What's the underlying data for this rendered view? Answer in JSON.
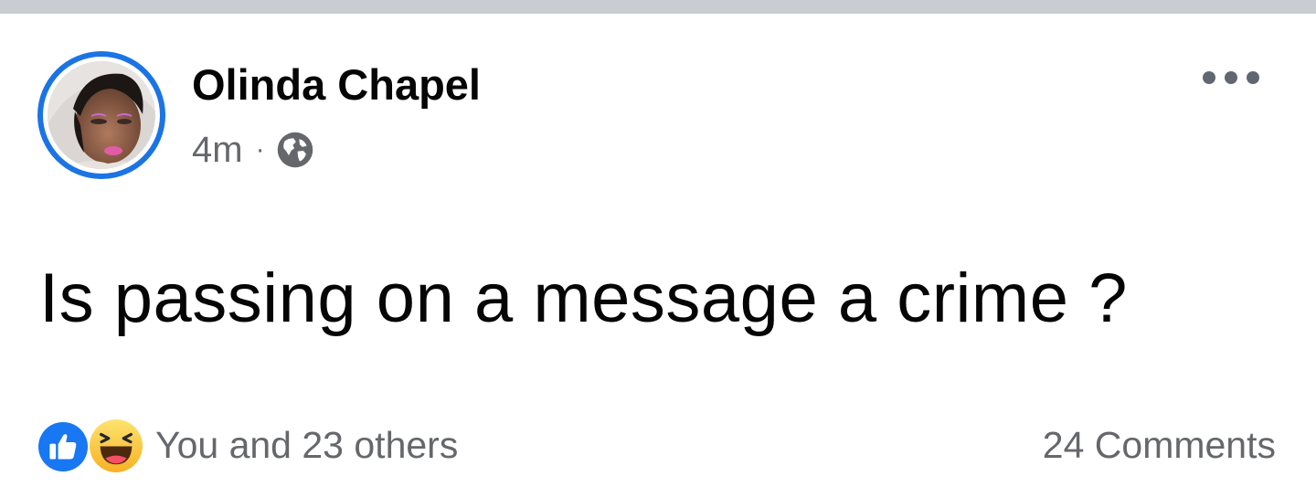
{
  "post": {
    "author_name": "Olinda Chapel",
    "timestamp": "4m",
    "separator": "·",
    "privacy_icon": "globe-icon",
    "more_icon": "more-options-icon",
    "text": "Is passing on a message a crime ?"
  },
  "footer": {
    "reaction_icons": [
      "like-icon",
      "haha-icon"
    ],
    "reactions_summary": "You and 23 others",
    "comments_count": "24 Comments"
  },
  "colors": {
    "accent": "#1b74e4",
    "like_blue": "#1877f2",
    "haha_yellow": "#f7b125",
    "secondary_text": "#65676b",
    "primary_text": "#050505",
    "top_bar": "#c9ccd1"
  }
}
